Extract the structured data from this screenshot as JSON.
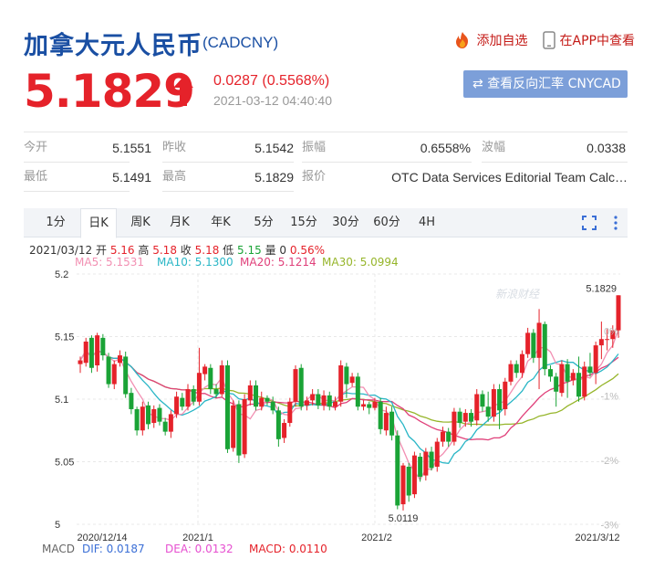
{
  "header": {
    "title": "加拿大元人民币",
    "code": "(CADCNY)",
    "add_watchlist": "添加自选",
    "view_in_app": "在APP中查看"
  },
  "quote": {
    "price": "5.1829",
    "direction": "up",
    "change": "0.0287 (0.5568%)",
    "timestamp": "2021-03-12 04:40:40",
    "reverse_button": "查看反向汇率 CNYCAD"
  },
  "stats": {
    "row1": [
      {
        "label": "今开",
        "value": "5.1551"
      },
      {
        "label": "昨收",
        "value": "5.1542"
      },
      {
        "label": "振幅",
        "value": "0.6558%"
      },
      {
        "label": "波幅",
        "value": "0.0338"
      }
    ],
    "row2": [
      {
        "label": "最低",
        "value": "5.1491"
      },
      {
        "label": "最高",
        "value": "5.1829"
      },
      {
        "label": "报价",
        "value": "OTC Data Services Editorial Team Calc…"
      }
    ]
  },
  "tabs": [
    "1分",
    "日K",
    "周K",
    "月K",
    "年K",
    "5分",
    "15分",
    "30分",
    "60分",
    "4H"
  ],
  "active_tab": "日K",
  "ohlc_legend": {
    "date": "2021/03/12",
    "open_label": "开",
    "open": "5.16",
    "high_label": "高",
    "high": "5.18",
    "close_label": "收",
    "close": "5.18",
    "low_label": "低",
    "low": "5.15",
    "vol_label": "量",
    "vol": "0",
    "pct": "0.56%"
  },
  "ma_legend": [
    {
      "label": "MA5: 5.1531",
      "color": "#f28fb2"
    },
    {
      "label": "MA10: 5.1300",
      "color": "#29b6c6"
    },
    {
      "label": "MA20: 5.1214",
      "color": "#e0407a"
    },
    {
      "label": "MA30: 5.0994",
      "color": "#96b52a"
    }
  ],
  "macd": {
    "label": "MACD",
    "dif": "DIF: 0.0187",
    "dea": "DEA: 0.0132",
    "macd": "MACD: 0.0110",
    "dif_color": "#3b6fd6",
    "dea_color": "#e64fd0",
    "macd_color": "#e5222a"
  },
  "colors": {
    "up": "#e5222a",
    "down": "#1aa336",
    "title": "#1a4fa3",
    "button": "#7c9fd9"
  },
  "chart_data": {
    "type": "candlestick",
    "y_ticks": [
      "5.2",
      "5.15",
      "5.1",
      "5.05",
      "5"
    ],
    "y_range": [
      5.0,
      5.2
    ],
    "right_ticks": [
      "1%",
      "0%",
      "-1%",
      "-2%",
      "-3%"
    ],
    "x_ticks": [
      "2020/12/14",
      "2021/1",
      "2021/2",
      "2021/3/12"
    ],
    "max_label": "5.1829",
    "min_label": "5.0119",
    "watermark": "新浪财经",
    "candles": [
      [
        5.128,
        5.131,
        5.121,
        5.134,
        0
      ],
      [
        5.129,
        5.146,
        5.126,
        5.149,
        0
      ],
      [
        5.149,
        5.125,
        5.121,
        5.151,
        0
      ],
      [
        5.127,
        5.151,
        5.122,
        5.153,
        0
      ],
      [
        5.149,
        5.135,
        5.131,
        5.152,
        0
      ],
      [
        5.134,
        5.112,
        5.109,
        5.137,
        0
      ],
      [
        5.112,
        5.128,
        5.108,
        5.131,
        0
      ],
      [
        5.129,
        5.135,
        5.126,
        5.139,
        0
      ],
      [
        5.134,
        5.104,
        5.101,
        5.138,
        0
      ],
      [
        5.105,
        5.092,
        5.088,
        5.109,
        0
      ],
      [
        5.092,
        5.075,
        5.071,
        5.094,
        0
      ],
      [
        5.075,
        5.094,
        5.071,
        5.098,
        0
      ],
      [
        5.095,
        5.08,
        5.076,
        5.098,
        0
      ],
      [
        5.081,
        5.092,
        5.077,
        5.095,
        0
      ],
      [
        5.093,
        5.082,
        5.079,
        5.096,
        0
      ],
      [
        5.082,
        5.074,
        5.071,
        5.085,
        0
      ],
      [
        5.074,
        5.088,
        5.069,
        5.091,
        0
      ],
      [
        5.088,
        5.102,
        5.085,
        5.106,
        0
      ],
      [
        5.101,
        5.094,
        5.091,
        5.105,
        0
      ],
      [
        5.094,
        5.108,
        5.091,
        5.112,
        0
      ],
      [
        5.108,
        5.098,
        5.095,
        5.111,
        0
      ],
      [
        5.098,
        5.121,
        5.095,
        5.141,
        0
      ],
      [
        5.12,
        5.126,
        5.115,
        5.128,
        0
      ],
      [
        5.125,
        5.108,
        5.104,
        5.128,
        0
      ],
      [
        5.108,
        5.104,
        5.101,
        5.112,
        0
      ],
      [
        5.104,
        5.127,
        5.102,
        5.131,
        0
      ],
      [
        5.127,
        5.06,
        5.057,
        5.131,
        0
      ],
      [
        5.061,
        5.095,
        5.058,
        5.099,
        0
      ],
      [
        5.096,
        5.055,
        5.049,
        5.099,
        0
      ],
      [
        5.056,
        5.1,
        5.053,
        5.104,
        0
      ],
      [
        5.099,
        5.111,
        5.095,
        5.115,
        0
      ],
      [
        5.111,
        5.094,
        5.091,
        5.115,
        0
      ],
      [
        5.094,
        5.101,
        5.091,
        5.106,
        0
      ],
      [
        5.101,
        5.098,
        5.095,
        5.103,
        0
      ],
      [
        5.098,
        5.091,
        5.088,
        5.102,
        0
      ],
      [
        5.091,
        5.068,
        5.062,
        5.094,
        0
      ],
      [
        5.069,
        5.081,
        5.065,
        5.084,
        0
      ],
      [
        5.081,
        5.098,
        5.078,
        5.101,
        0
      ],
      [
        5.098,
        5.124,
        5.094,
        5.127,
        0
      ],
      [
        5.125,
        5.094,
        5.091,
        5.128,
        0
      ],
      [
        5.095,
        5.099,
        5.091,
        5.102,
        0
      ],
      [
        5.099,
        5.104,
        5.095,
        5.108,
        0
      ],
      [
        5.104,
        5.095,
        5.092,
        5.108,
        0
      ],
      [
        5.095,
        5.103,
        5.091,
        5.107,
        0
      ],
      [
        5.103,
        5.094,
        5.091,
        5.106,
        0
      ],
      [
        5.094,
        5.098,
        5.091,
        5.102,
        0
      ],
      [
        5.098,
        5.127,
        5.094,
        5.131,
        0
      ],
      [
        5.126,
        5.112,
        5.101,
        5.129,
        0
      ],
      [
        5.113,
        5.118,
        5.11,
        5.121,
        0
      ],
      [
        5.118,
        5.094,
        5.091,
        5.121,
        0
      ],
      [
        5.094,
        5.096,
        5.091,
        5.099,
        0
      ],
      [
        5.096,
        5.093,
        5.088,
        5.098,
        0
      ],
      [
        5.093,
        5.098,
        5.091,
        5.101,
        0
      ],
      [
        5.098,
        5.076,
        5.072,
        5.101,
        0
      ],
      [
        5.075,
        5.089,
        5.071,
        5.094,
        0
      ],
      [
        5.09,
        5.071,
        5.067,
        5.094,
        0
      ],
      [
        5.071,
        5.015,
        5.012,
        5.075,
        0
      ],
      [
        5.016,
        5.047,
        5.011,
        5.049,
        0
      ],
      [
        5.046,
        5.023,
        5.018,
        5.049,
        0
      ],
      [
        5.024,
        5.055,
        5.021,
        5.058,
        0
      ],
      [
        5.054,
        5.038,
        5.034,
        5.057,
        0
      ],
      [
        5.039,
        5.058,
        5.035,
        5.061,
        0
      ],
      [
        5.058,
        5.045,
        5.043,
        5.062,
        0
      ],
      [
        5.046,
        5.066,
        5.042,
        5.069,
        0
      ],
      [
        5.066,
        5.074,
        5.062,
        5.078,
        0
      ],
      [
        5.074,
        5.066,
        5.062,
        5.077,
        0
      ],
      [
        5.066,
        5.09,
        5.063,
        5.093,
        0
      ],
      [
        5.09,
        5.081,
        5.077,
        5.093,
        0
      ],
      [
        5.082,
        5.089,
        5.078,
        5.092,
        0
      ],
      [
        5.089,
        5.082,
        5.078,
        5.092,
        0
      ],
      [
        5.083,
        5.104,
        5.079,
        5.108,
        0
      ],
      [
        5.104,
        5.094,
        5.09,
        5.107,
        0
      ],
      [
        5.094,
        5.086,
        5.082,
        5.106,
        0
      ],
      [
        5.086,
        5.108,
        5.082,
        5.112,
        0
      ],
      [
        5.108,
        5.091,
        5.076,
        5.112,
        0
      ],
      [
        5.092,
        5.114,
        5.087,
        5.117,
        0
      ],
      [
        5.114,
        5.128,
        5.111,
        5.131,
        0
      ],
      [
        5.128,
        5.121,
        5.117,
        5.131,
        0
      ],
      [
        5.121,
        5.136,
        5.117,
        5.139,
        0
      ],
      [
        5.136,
        5.153,
        5.133,
        5.157,
        0
      ],
      [
        5.153,
        5.133,
        5.129,
        5.156,
        0
      ],
      [
        5.133,
        5.161,
        5.108,
        5.172,
        0
      ],
      [
        5.16,
        5.124,
        5.119,
        5.162,
        0
      ],
      [
        5.124,
        5.118,
        5.114,
        5.127,
        0
      ],
      [
        5.118,
        5.106,
        5.094,
        5.121,
        0
      ],
      [
        5.105,
        5.128,
        5.102,
        5.131,
        0
      ],
      [
        5.128,
        5.114,
        5.101,
        5.132,
        0
      ],
      [
        5.115,
        5.121,
        5.111,
        5.124,
        0
      ],
      [
        5.121,
        5.102,
        5.098,
        5.134,
        0
      ],
      [
        5.102,
        5.126,
        5.099,
        5.13,
        0
      ],
      [
        5.126,
        5.121,
        5.118,
        5.137,
        0
      ],
      [
        5.121,
        5.143,
        5.112,
        5.146,
        0
      ],
      [
        5.143,
        5.148,
        5.132,
        5.162,
        0
      ],
      [
        5.148,
        5.148,
        5.139,
        5.156,
        0
      ],
      [
        5.148,
        5.155,
        5.141,
        5.159,
        0
      ],
      [
        5.155,
        5.183,
        5.149,
        5.183,
        0
      ]
    ]
  }
}
